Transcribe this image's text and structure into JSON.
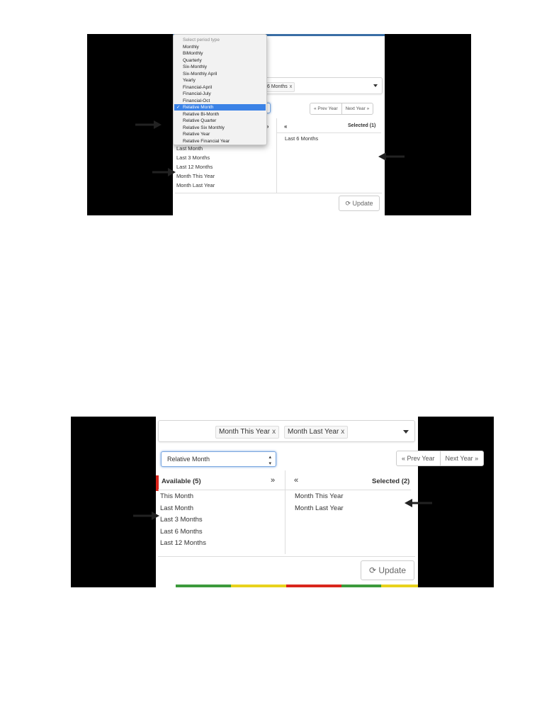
{
  "shot1": {
    "dropdown": {
      "header": "Select period type",
      "options": [
        "Monthly",
        "BiMonthly",
        "Quarterly",
        "Six-Monthly",
        "Six-Monthly April",
        "Yearly",
        "Financial-April",
        "Financial-July",
        "Financial-Oct",
        "Relative Month",
        "Relative Bi-Month",
        "Relative Quarter",
        "Relative Six Monthly",
        "Relative Year",
        "Relative Financial Year"
      ],
      "selected": "Relative Month",
      "check": "✓"
    },
    "tag_partial": "6 Months",
    "tag_remove": "x",
    "prev_year": "« Prev Year",
    "next_year": "Next Year »",
    "move_all_right": "»",
    "move_all_left": "«",
    "selected_header": "Selected (1)",
    "available_visible": [
      "Last Month",
      "Last 3 Months",
      "Last 12 Months",
      "Month This Year",
      "Month Last Year"
    ],
    "selected_items": [
      "Last 6 Months"
    ],
    "update_label": "Update",
    "update_icon": "refresh-icon"
  },
  "shot2": {
    "tags": [
      "Month This Year",
      "Month Last Year"
    ],
    "tag_remove": "x",
    "period_type": "Relative Month",
    "prev_year": "« Prev Year",
    "next_year": "Next Year »",
    "available_header": "Available (5)",
    "move_all_right": "»",
    "move_all_left": "«",
    "selected_header": "Selected (2)",
    "available_items": [
      "This Month",
      "Last Month",
      "Last 3 Months",
      "Last 6 Months",
      "Last 12 Months"
    ],
    "selected_items": [
      "Month This Year",
      "Month Last Year"
    ],
    "update_label": "Update",
    "update_icon": "refresh-icon"
  },
  "colors": {
    "highlight": "#3b82e6",
    "focus_border": "#7aa7e0",
    "red_marker": "#d9251c",
    "top_border": "#3a6ea5",
    "stripe_green": "#3c9a3c",
    "stripe_yellow": "#e8d21d",
    "stripe_red": "#d9251c"
  }
}
